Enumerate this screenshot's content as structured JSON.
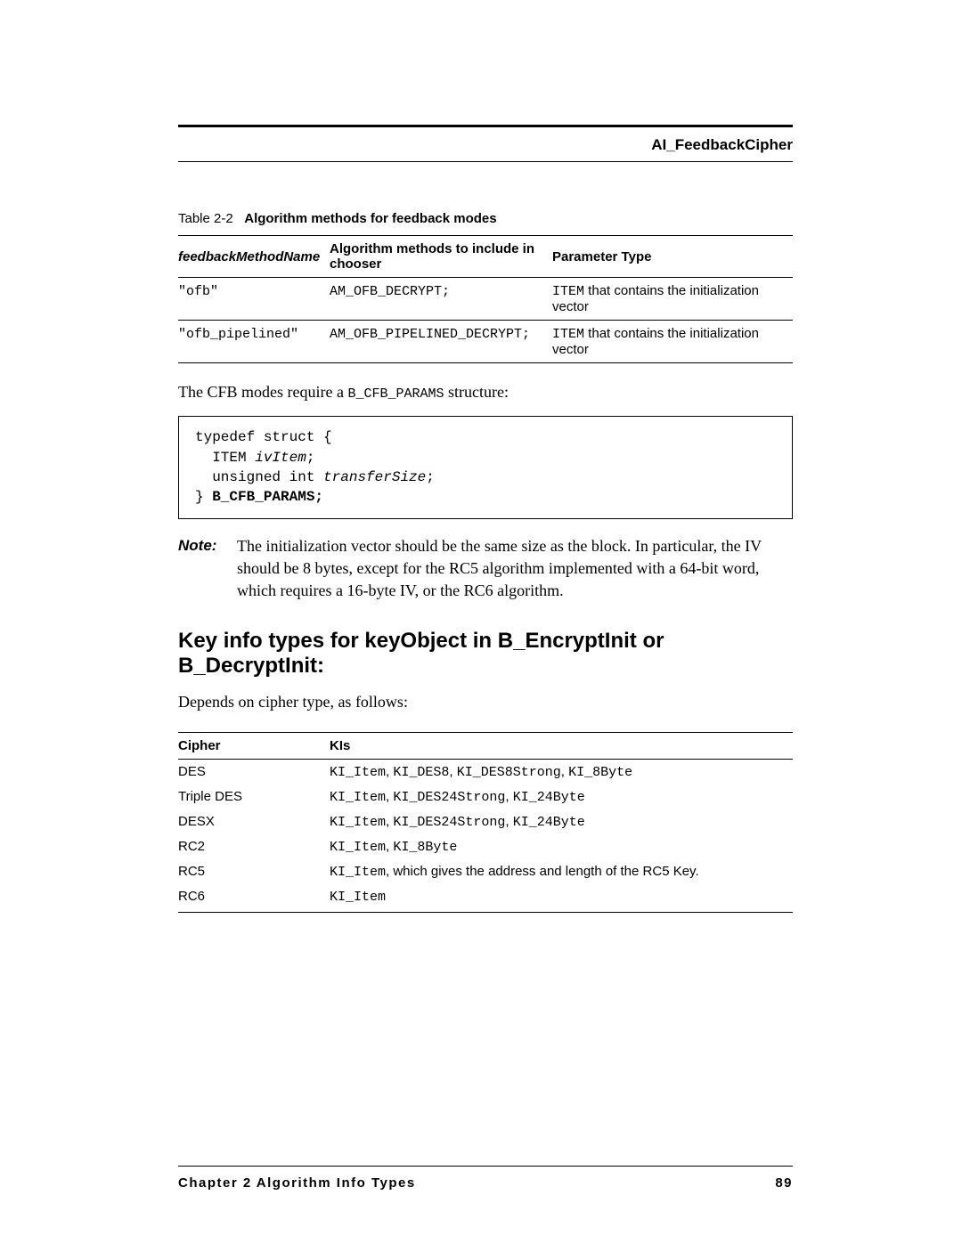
{
  "header": {
    "title": "AI_FeedbackCipher"
  },
  "table1": {
    "caption_prefix": "Table 2-2",
    "caption_title": "Algorithm methods for feedback modes",
    "headers": {
      "col1": "feedbackMethodName",
      "col2": "Algorithm methods to include in chooser",
      "col3": "Parameter Type"
    },
    "rows": [
      {
        "name": "\"ofb\"",
        "method": "AM_OFB_DECRYPT;",
        "param_prefix": "ITEM",
        "param_suffix": " that contains the initialization vector"
      },
      {
        "name": "\"ofb_pipelined\"",
        "method": "AM_OFB_PIPELINED_DECRYPT;",
        "param_prefix": "ITEM",
        "param_suffix": " that contains the initialization vector"
      }
    ]
  },
  "para1_prefix": "The CFB modes require a ",
  "para1_code": "B_CFB_PARAMS",
  "para1_suffix": " structure:",
  "codeblock": {
    "l1": "typedef struct {",
    "l2a": "  ITEM ",
    "l2b": "ivItem",
    "l2c": ";",
    "l3a": "  unsigned int ",
    "l3b": "transferSize",
    "l3c": ";",
    "l4a": "} ",
    "l4b": "B_CFB_PARAMS",
    "l4c": ";"
  },
  "note": {
    "label": "Note:",
    "text": "The initialization vector should be the same size as the block. In particular, the IV should be 8 bytes, except for the RC5 algorithm implemented with a 64-bit word, which requires a 16-byte IV, or the RC6 algorithm."
  },
  "heading": "Key info types for keyObject in B_EncryptInit or B_DecryptInit:",
  "para2": "Depends on cipher type, as follows:",
  "table2": {
    "headers": {
      "col1": "Cipher",
      "col2": "KIs"
    },
    "rows": [
      {
        "cipher": "DES",
        "kis_codes": [
          "KI_Item",
          "KI_DES8",
          "KI_DES8Strong",
          "KI_8Byte"
        ],
        "kis_text": ""
      },
      {
        "cipher": "Triple DES",
        "kis_codes": [
          "KI_Item",
          "KI_DES24Strong",
          "KI_24Byte"
        ],
        "kis_text": ""
      },
      {
        "cipher": "DESX",
        "kis_codes": [
          "KI_Item",
          "KI_DES24Strong",
          "KI_24Byte"
        ],
        "kis_text": ""
      },
      {
        "cipher": "RC2",
        "kis_codes": [
          "KI_Item",
          "KI_8Byte"
        ],
        "kis_text": ""
      },
      {
        "cipher": "RC5",
        "kis_codes": [
          "KI_Item"
        ],
        "kis_text": ", which gives the address and length of the RC5 Key."
      },
      {
        "cipher": "RC6",
        "kis_codes": [
          "KI_Item"
        ],
        "kis_text": ""
      }
    ]
  },
  "footer": {
    "left": "Chapter 2  Algorithm Info Types",
    "right": "89"
  }
}
